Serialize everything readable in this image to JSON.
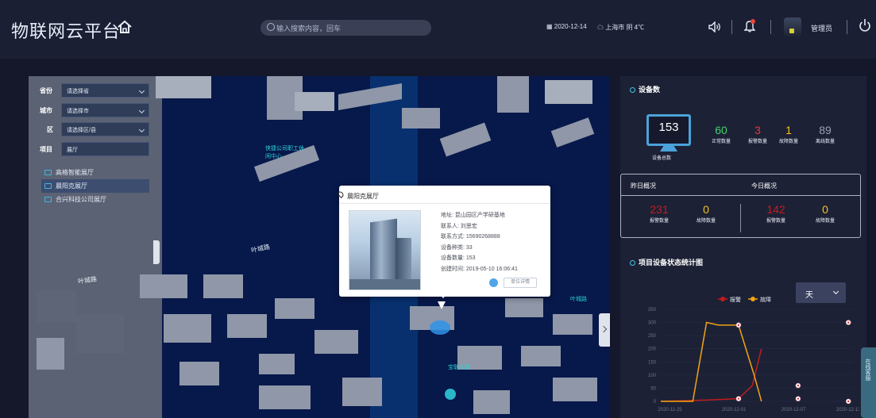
{
  "header": {
    "title": "物联网云平台",
    "search_placeholder": "输入搜索内容，回车",
    "date": "2020-12-14",
    "weather": "上海市 阴 4℃",
    "user": "管理员"
  },
  "filter": {
    "province_label": "省份",
    "province_value": "请选择省",
    "city_label": "城市",
    "city_value": "请选择市",
    "district_label": "区",
    "district_value": "请选择区/县",
    "project_label": "项目",
    "project_value": "展厅",
    "tree": [
      "高格智能展厅",
      "晨阳克展厅",
      "合兴科技公司展厅"
    ]
  },
  "map": {
    "road1": "叶城路",
    "road2": "叶城路",
    "labels": [
      "侠捷公司职工休闲中心",
      "叶城路",
      "宝联大厦"
    ]
  },
  "popup": {
    "title": "晨阳克展厅",
    "address": "地址: 昆山园区产学研基地",
    "contact": "联系人: 刘思宏",
    "phone": "联系方式: 15690268888",
    "device_types": "设备种类: 33",
    "device_count": "设备数量: 153",
    "created": "创建时间: 2019-05-10 16:06:41",
    "button": "单位详情"
  },
  "devices": {
    "title": "设备数",
    "total": "153",
    "total_label": "设备总数",
    "normal": "60",
    "normal_label": "正常数量",
    "alarm": "3",
    "alarm_label": "报警数量",
    "fault": "1",
    "fault_label": "故障数量",
    "offline": "89",
    "offline_label": "离线数量"
  },
  "overview": {
    "yesterday_title": "昨日概况",
    "today_title": "今日概况",
    "y_alarm": "231",
    "y_alarm_label": "报警数量",
    "y_fault": "0",
    "y_fault_label": "故障数量",
    "t_alarm": "142",
    "t_alarm_label": "报警数量",
    "t_fault": "0",
    "t_fault_label": "故障数量"
  },
  "chart_section": {
    "title": "项目设备状态统计图",
    "range_value": "天",
    "float_tab": "在线客服"
  },
  "colors": {
    "accent": "#42c7e6",
    "normal": "#3ed36b",
    "alarm": "#e33a3a",
    "fault": "#f4c419",
    "offline": "#9aa2b4",
    "alarm_line": "#c21d1d",
    "fault_line": "#f0a512"
  },
  "chart_data": {
    "type": "line",
    "x": [
      "2020-11-25",
      "2020-12-01",
      "2020-12-07",
      "2020-12-13"
    ],
    "ylim": [
      0,
      350
    ],
    "yticks": [
      0,
      50,
      100,
      150,
      200,
      250,
      300,
      350
    ],
    "legend": [
      "报警",
      "故障"
    ],
    "legend_position": "top",
    "series": [
      {
        "name": "报警",
        "points": [
          [
            0,
            0
          ],
          [
            5,
            5
          ],
          [
            8.5,
            10
          ],
          [
            10,
            60
          ],
          [
            11,
            200
          ]
        ]
      },
      {
        "name": "故障",
        "points": [
          [
            0,
            0
          ],
          [
            3.5,
            0
          ],
          [
            5,
            300
          ],
          [
            6.3,
            290
          ],
          [
            8.5,
            290
          ],
          [
            10.2,
            100
          ],
          [
            11,
            0
          ]
        ]
      }
    ],
    "markers": [
      [
        8.5,
        290
      ],
      [
        8.5,
        10
      ],
      [
        15,
        60
      ],
      [
        15,
        10
      ],
      [
        20.5,
        300
      ],
      [
        20.5,
        0
      ]
    ],
    "x_max": 21
  }
}
